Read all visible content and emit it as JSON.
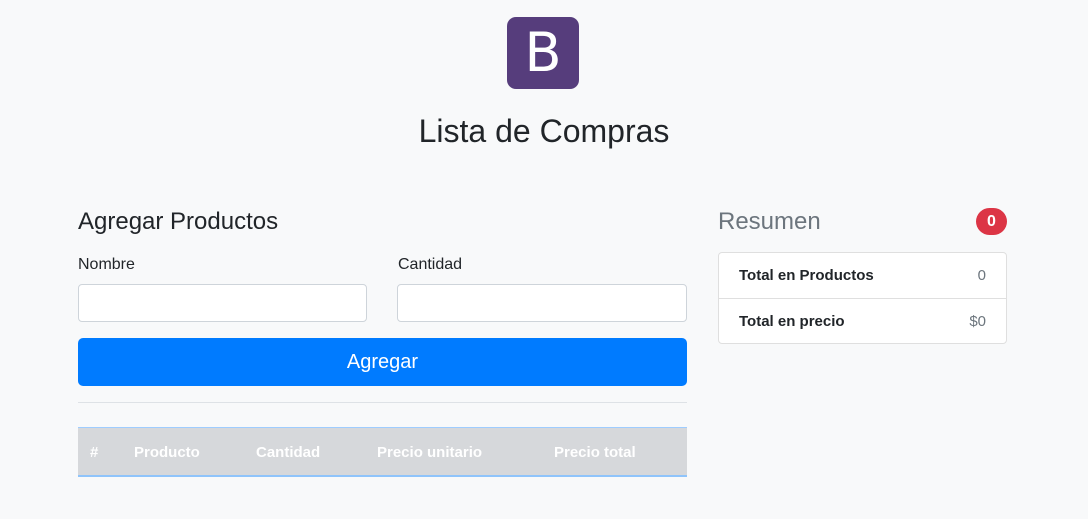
{
  "logo": {
    "letter": "B",
    "color": "#563d7c"
  },
  "page_title": "Lista de Compras",
  "add_form": {
    "title": "Agregar Productos",
    "name_label": "Nombre",
    "name_value": "",
    "qty_label": "Cantidad",
    "qty_value": "",
    "button_label": "Agregar",
    "button_color": "#007bff"
  },
  "table": {
    "headers": [
      "#",
      "Producto",
      "Cantidad",
      "Precio unitario",
      "Precio total"
    ],
    "rows": []
  },
  "summary": {
    "title": "Resumen",
    "badge": "0",
    "badge_color": "#dc3545",
    "items": [
      {
        "label": "Total en Productos",
        "value": "0"
      },
      {
        "label": "Total en precio",
        "value": "$0"
      }
    ]
  }
}
